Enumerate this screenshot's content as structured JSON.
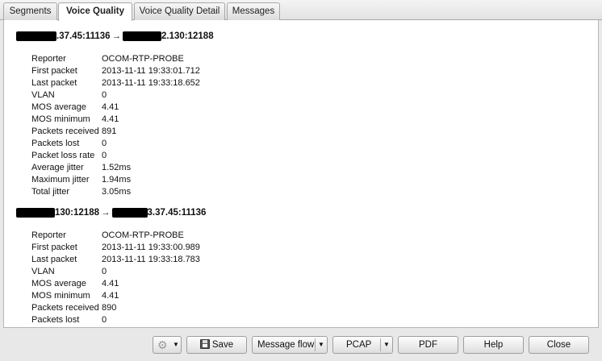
{
  "tabs": [
    {
      "label": "Segments",
      "active": false
    },
    {
      "label": "Voice Quality",
      "active": true
    },
    {
      "label": "Voice Quality Detail",
      "active": false
    },
    {
      "label": "Messages",
      "active": false
    }
  ],
  "flows": [
    {
      "title_left": ".37.45:11136",
      "arrow": "→",
      "title_right": "2.130:12188",
      "stats": [
        {
          "label": "Reporter",
          "value": "OCOM-RTP-PROBE"
        },
        {
          "label": "First packet",
          "value": "2013-11-11 19:33:01.712"
        },
        {
          "label": "Last packet",
          "value": "2013-11-11 19:33:18.652"
        },
        {
          "label": "VLAN",
          "value": "0"
        },
        {
          "label": "MOS average",
          "value": "4.41"
        },
        {
          "label": "MOS minimum",
          "value": "4.41"
        },
        {
          "label": "Packets received",
          "value": "891"
        },
        {
          "label": "Packets lost",
          "value": "0"
        },
        {
          "label": "Packet loss rate",
          "value": "0"
        },
        {
          "label": "Average jitter",
          "value": "1.52ms"
        },
        {
          "label": "Maximum jitter",
          "value": "1.94ms"
        },
        {
          "label": "Total jitter",
          "value": "3.05ms"
        }
      ]
    },
    {
      "title_left": "130:12188",
      "arrow": "→",
      "title_right": "3.37.45:11136",
      "stats": [
        {
          "label": "Reporter",
          "value": "OCOM-RTP-PROBE"
        },
        {
          "label": "First packet",
          "value": "2013-11-11 19:33:00.989"
        },
        {
          "label": "Last packet",
          "value": "2013-11-11 19:33:18.783"
        },
        {
          "label": "VLAN",
          "value": "0"
        },
        {
          "label": "MOS average",
          "value": "4.41"
        },
        {
          "label": "MOS minimum",
          "value": "4.41"
        },
        {
          "label": "Packets received",
          "value": "890"
        },
        {
          "label": "Packets lost",
          "value": "0"
        }
      ]
    }
  ],
  "toolbar": {
    "settings_icon": "gear-icon",
    "save_icon": "floppy-disk-icon",
    "save_label": "Save",
    "message_flow_label": "Message flow",
    "pcap_label": "PCAP",
    "pdf_label": "PDF",
    "help_label": "Help",
    "close_label": "Close",
    "dropdown_icon": "caret-down-icon"
  }
}
